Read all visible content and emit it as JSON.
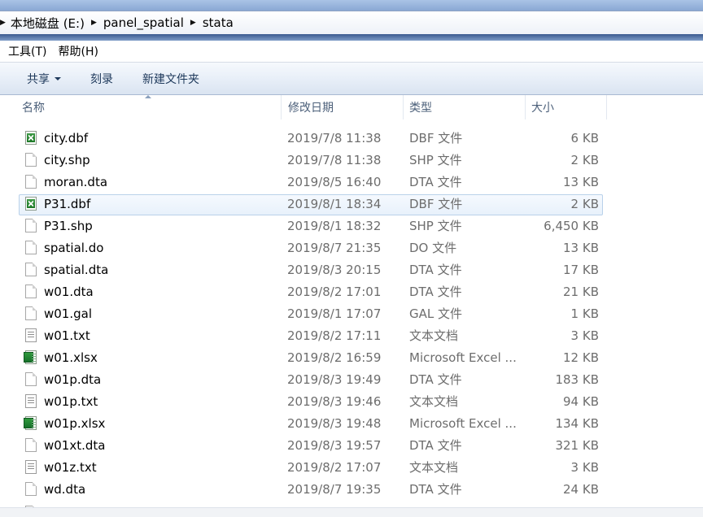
{
  "address": {
    "crumbs": [
      "本地磁盘 (E:)",
      "panel_spatial",
      "stata"
    ],
    "separator": "▶"
  },
  "menubar": {
    "items": [
      "工具(T)",
      "帮助(H)"
    ]
  },
  "commandbar": {
    "share_label": "共享",
    "burn_label": "刻录",
    "newfolder_label": "新建文件夹"
  },
  "columns": {
    "name": "名称",
    "date": "修改日期",
    "type": "类型",
    "size": "大小"
  },
  "files": [
    {
      "name": "city.dbf",
      "date": "2019/7/8 11:38",
      "type": "DBF 文件",
      "size": "6 KB",
      "icon": "dbf-file-icon"
    },
    {
      "name": "city.shp",
      "date": "2019/7/8 11:38",
      "type": "SHP 文件",
      "size": "2 KB",
      "icon": "blank-file-icon"
    },
    {
      "name": "moran.dta",
      "date": "2019/8/5 16:40",
      "type": "DTA 文件",
      "size": "13 KB",
      "icon": "blank-file-icon"
    },
    {
      "name": "P31.dbf",
      "date": "2019/8/1 18:34",
      "type": "DBF 文件",
      "size": "2 KB",
      "icon": "dbf-file-icon",
      "selected": true
    },
    {
      "name": "P31.shp",
      "date": "2019/8/1 18:32",
      "type": "SHP 文件",
      "size": "6,450 KB",
      "icon": "blank-file-icon"
    },
    {
      "name": "spatial.do",
      "date": "2019/8/7 21:35",
      "type": "DO 文件",
      "size": "13 KB",
      "icon": "blank-file-icon"
    },
    {
      "name": "spatial.dta",
      "date": "2019/8/3 20:15",
      "type": "DTA 文件",
      "size": "17 KB",
      "icon": "blank-file-icon"
    },
    {
      "name": "w01.dta",
      "date": "2019/8/2 17:01",
      "type": "DTA 文件",
      "size": "21 KB",
      "icon": "blank-file-icon"
    },
    {
      "name": "w01.gal",
      "date": "2019/8/1 17:07",
      "type": "GAL 文件",
      "size": "1 KB",
      "icon": "blank-file-icon"
    },
    {
      "name": "w01.txt",
      "date": "2019/8/2 17:11",
      "type": "文本文档",
      "size": "3 KB",
      "icon": "text-file-icon"
    },
    {
      "name": "w01.xlsx",
      "date": "2019/8/2 16:59",
      "type": "Microsoft Excel ...",
      "size": "12 KB",
      "icon": "excel-file-icon"
    },
    {
      "name": "w01p.dta",
      "date": "2019/8/3 19:49",
      "type": "DTA 文件",
      "size": "183 KB",
      "icon": "blank-file-icon"
    },
    {
      "name": "w01p.txt",
      "date": "2019/8/3 19:46",
      "type": "文本文档",
      "size": "94 KB",
      "icon": "text-file-icon"
    },
    {
      "name": "w01p.xlsx",
      "date": "2019/8/3 19:48",
      "type": "Microsoft Excel ...",
      "size": "134 KB",
      "icon": "excel-file-icon"
    },
    {
      "name": "w01xt.dta",
      "date": "2019/8/3 19:57",
      "type": "DTA 文件",
      "size": "321 KB",
      "icon": "blank-file-icon"
    },
    {
      "name": "w01z.txt",
      "date": "2019/8/2 17:07",
      "type": "文本文档",
      "size": "3 KB",
      "icon": "text-file-icon"
    },
    {
      "name": "wd.dta",
      "date": "2019/8/7 19:35",
      "type": "DTA 文件",
      "size": "24 KB",
      "icon": "blank-file-icon"
    }
  ]
}
